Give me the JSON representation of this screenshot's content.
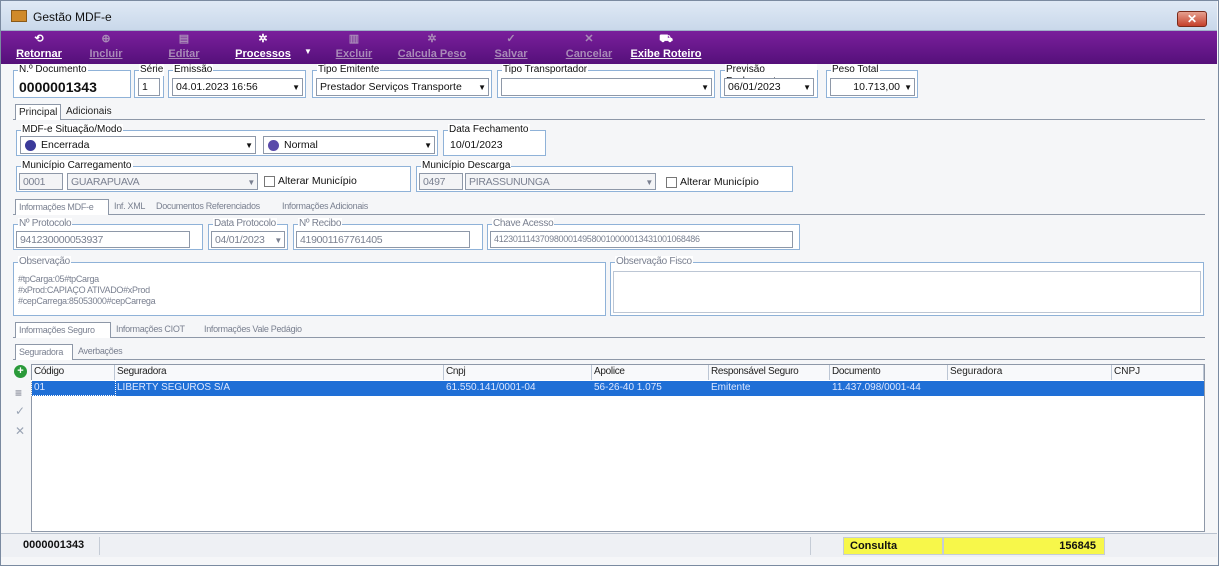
{
  "window": {
    "title": "Gestão MDF-e",
    "close": "✕"
  },
  "toolbar": {
    "retornar": "Retornar",
    "incluir": "Incluir",
    "editar": "Editar",
    "processos": "Processos",
    "excluir": "Excluir",
    "calcula_peso": "Calcula Peso",
    "salvar": "Salvar",
    "cancelar": "Cancelar",
    "exibe_roteiro": "Exibe Roteiro",
    "dropdown": "▼"
  },
  "header": {
    "doc_label": "N.º Documento",
    "doc_value": "0000001343",
    "serie_label": "Série",
    "serie_value": "1",
    "emissao_label": "Emissão",
    "emissao_value": "04.01.2023 16:56",
    "tipo_emitente_label": "Tipo Emitente",
    "tipo_emitente_value": "Prestador Serviços Transporte",
    "tipo_transportador_label": "Tipo Transportador",
    "tipo_transportador_value": "",
    "previsao_label": "Previsão Fechamento",
    "previsao_value": "06/01/2023",
    "peso_label": "Peso Total",
    "peso_value": "10.713,00"
  },
  "main_tabs": [
    "Principal",
    "Adicionais"
  ],
  "situacao": {
    "label": "MDF-e Situação/Modo",
    "situacao_value": "Encerrada",
    "modo_value": "Normal",
    "fechamento_label": "Data Fechamento",
    "fechamento_value": "10/01/2023"
  },
  "carregamento": {
    "label": "Município Carregamento",
    "code": "0001",
    "name": "GUARAPUAVA",
    "alter": "Alterar Município"
  },
  "descarga": {
    "label": "Município Descarga",
    "code": "0497",
    "name": "PIRASSUNUNGA",
    "alter": "Alterar Município"
  },
  "info_tabs": [
    "Informações MDF-e",
    "Inf. XML",
    "Documentos Referenciados",
    "Informações Adicionais"
  ],
  "protocolo": {
    "protocolo_label": "Nº Protocolo",
    "protocolo_value": "941230000053937",
    "data_label": "Data Protocolo",
    "data_value": "04/01/2023",
    "recibo_label": "Nº Recibo",
    "recibo_value": "419001167761405",
    "chave_label": "Chave Acesso",
    "chave_value": "41230111437098000149580010000013431001068486"
  },
  "observacao": {
    "label": "Observação",
    "lines": [
      "#tpCarga:05#tpCarga",
      "#xProd:CAPIAÇO ATIVADO#xProd",
      "#cepCarrega:85053000#cepCarrega"
    ],
    "fisco_label": "Observação Fisco"
  },
  "seguro_tabs": [
    "Informações Seguro",
    "Informações CIOT",
    "Informações Vale Pedágio"
  ],
  "seg_tabs": [
    "Seguradora",
    "Averbações"
  ],
  "grid": {
    "headers": [
      "Código",
      "Seguradora",
      "Cnpj",
      "Apolice",
      "Responsável Seguro",
      "Documento",
      "Seguradora",
      "CNPJ"
    ],
    "row": [
      "01",
      "LIBERTY SEGUROS S/A",
      "61.550.141/0001-04",
      "56-26-40 1.075",
      "Emitente",
      "11.437.098/0001-44",
      "",
      ""
    ]
  },
  "side_icons": {
    "add": "+",
    "list": "≡",
    "check": "✓",
    "x": "✕"
  },
  "status": {
    "doc": "0000001343",
    "mode": "Consulta",
    "number": "156845"
  }
}
